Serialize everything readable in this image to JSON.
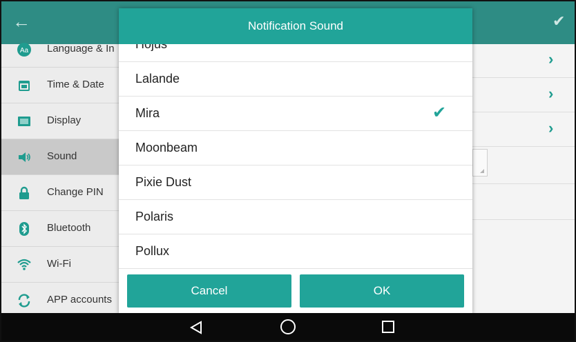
{
  "colors": {
    "accent": "#21a499",
    "topbar": "#2e8c84"
  },
  "sidebar": {
    "items": [
      {
        "label": "Language & In",
        "icon": "language-icon"
      },
      {
        "label": "Time & Date",
        "icon": "calendar-icon"
      },
      {
        "label": "Display",
        "icon": "display-icon"
      },
      {
        "label": "Sound",
        "icon": "speaker-icon",
        "active": true
      },
      {
        "label": "Change PIN",
        "icon": "lock-icon"
      },
      {
        "label": "Bluetooth",
        "icon": "bluetooth-icon"
      },
      {
        "label": "Wi-Fi",
        "icon": "wifi-icon"
      },
      {
        "label": "APP accounts",
        "icon": "sync-icon"
      }
    ]
  },
  "dialog": {
    "title": "Notification Sound",
    "options": [
      {
        "label": "Hojus"
      },
      {
        "label": "Lalande"
      },
      {
        "label": "Mira",
        "selected": true
      },
      {
        "label": "Moonbeam"
      },
      {
        "label": "Pixie Dust"
      },
      {
        "label": "Polaris"
      },
      {
        "label": "Pollux"
      }
    ],
    "cancel_label": "Cancel",
    "ok_label": "OK"
  },
  "icons": {
    "back": "back-arrow-icon",
    "confirm": "checkmark-icon",
    "nav_back": "nav-back-icon",
    "nav_home": "nav-home-icon",
    "nav_recent": "nav-recent-icon"
  }
}
